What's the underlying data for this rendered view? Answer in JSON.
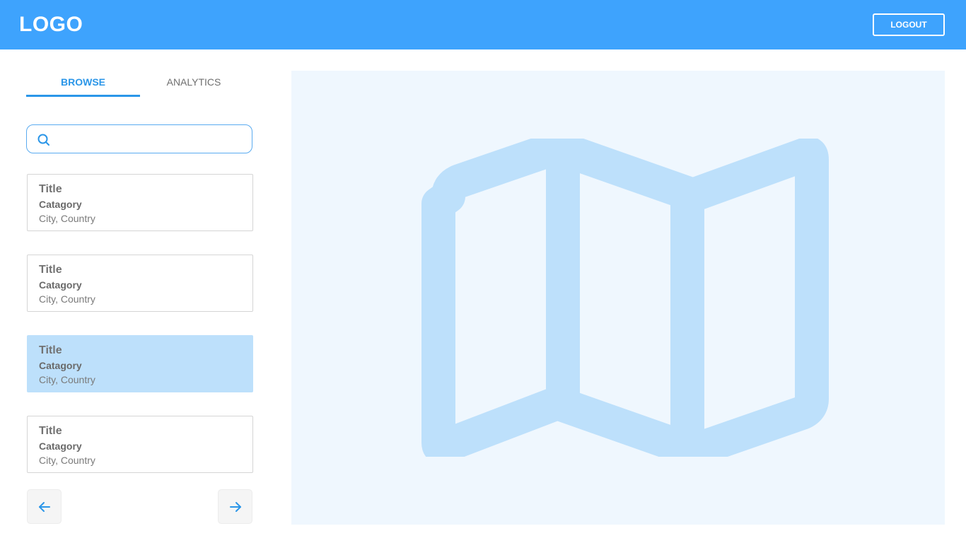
{
  "header": {
    "logo": "LOGO",
    "logout_label": "LOGOUT"
  },
  "tabs": [
    {
      "label": "BROWSE",
      "active": true
    },
    {
      "label": "ANALYTICS",
      "active": false
    }
  ],
  "search": {
    "value": "",
    "placeholder": "",
    "icon": "search-icon"
  },
  "cards": [
    {
      "title": "Title",
      "category": "Catagory",
      "location": "City, Country",
      "selected": false
    },
    {
      "title": "Title",
      "category": "Catagory",
      "location": "City, Country",
      "selected": false
    },
    {
      "title": "Title",
      "category": "Catagory",
      "location": "City, Country",
      "selected": true
    },
    {
      "title": "Title",
      "category": "Catagory",
      "location": "City, Country",
      "selected": false
    }
  ],
  "pagination": {
    "prev_icon": "arrow-left-icon",
    "next_icon": "arrow-right-icon"
  },
  "map": {
    "icon": "map-icon"
  },
  "colors": {
    "header_bg": "#3ea3fd",
    "accent": "#2b96e8",
    "selected_card": "#bde0fb",
    "map_bg": "#eff7fe",
    "map_icon": "#bde0fb"
  }
}
